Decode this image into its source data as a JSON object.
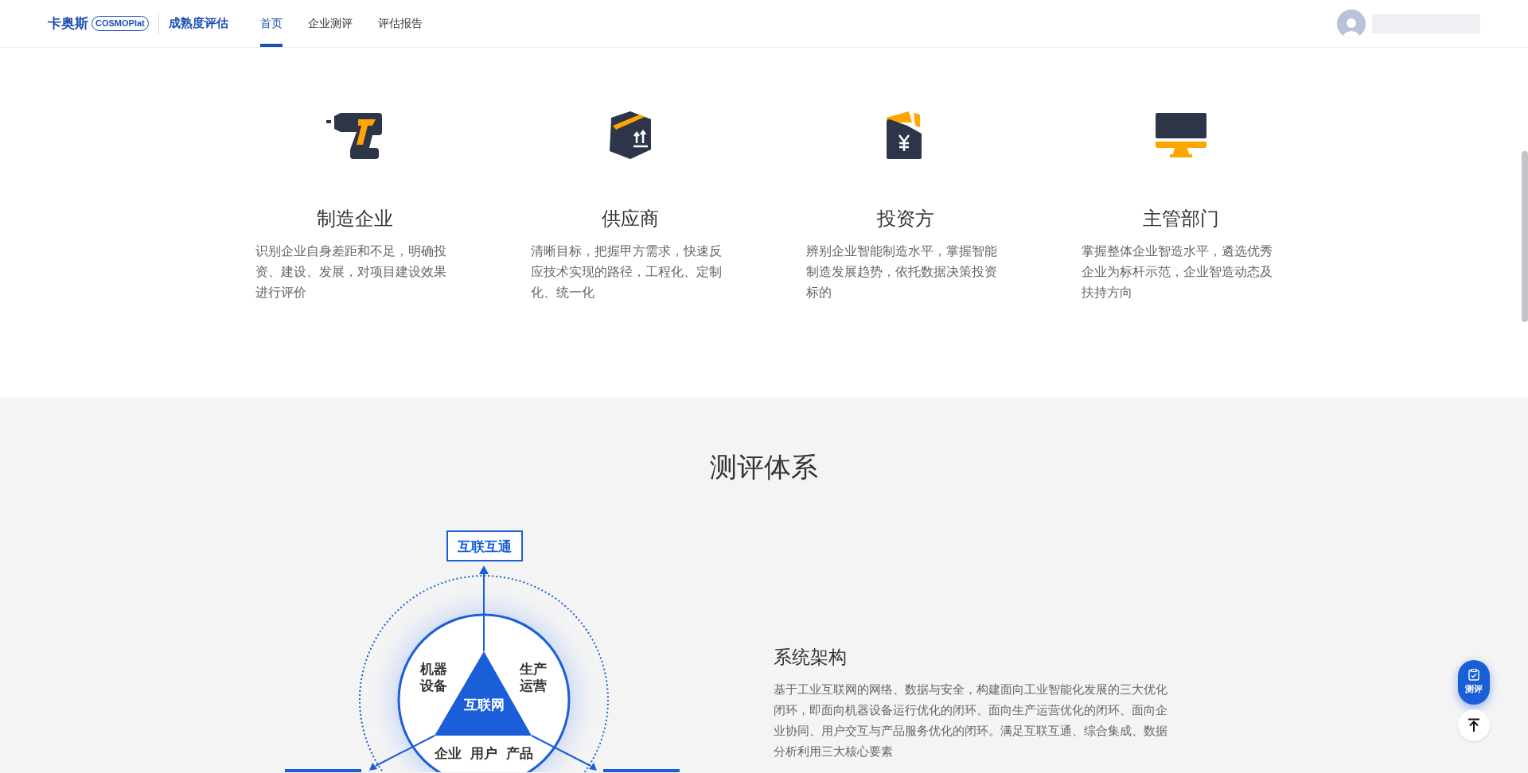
{
  "header": {
    "logo": {
      "brand": "卡奥斯",
      "sub": "COSMOPlat"
    },
    "product": "成熟度评估",
    "nav": [
      {
        "label": "首页",
        "selected": true
      },
      {
        "label": "企业测评",
        "selected": false
      },
      {
        "label": "评估报告",
        "selected": false
      }
    ]
  },
  "audiences": [
    {
      "kind": "drill",
      "title": "制造企业",
      "text": "识别企业自身差距和不足，明确投资、建设、发展，对项目建设效果进行评价"
    },
    {
      "kind": "box",
      "title": "供应商",
      "text": "清晰目标，把握甲方需求，快速反应技术实现的路径，工程化、定制化、统一化"
    },
    {
      "kind": "wallet",
      "title": "投资方",
      "text": "辨别企业智能制造水平，掌握智能制造发展趋势，依托数据决策投资标的"
    },
    {
      "kind": "monitor",
      "title": "主管部门",
      "text": "掌握整体企业智造水平，遴选优秀企业为标杆示范，企业智造动态及扶持方向"
    }
  ],
  "system": {
    "title": "测评体系",
    "diagram": {
      "top_box": "互联互通",
      "left": [
        "机器",
        "设备"
      ],
      "right": [
        "生产",
        "运营"
      ],
      "center": "互联网",
      "bottom": [
        "企业",
        "用户",
        "产品"
      ]
    },
    "architecture": {
      "title": "系统架构",
      "text": "基于工业互联网的网络、数据与安全，构建面向工业智能化发展的三大优化闭环，即面向机器设备运行优化的闭环、面向生产运营优化的闭环、面向企业协同、用户交互与产品服务优化的闭环。满足互联互通、综合集成、数据分析利用三大核心要素"
    }
  },
  "float_buttons": {
    "evaluate": "测评"
  }
}
